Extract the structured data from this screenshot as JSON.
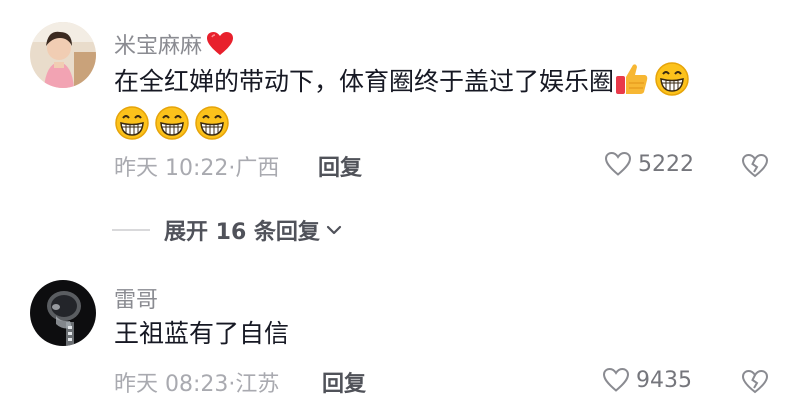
{
  "comments": [
    {
      "username": "米宝麻麻",
      "text": "在全红婵的带动下，体育圈终于盖过了娱乐圈",
      "time": "昨天 10:22·广西",
      "reply_label": "回复",
      "likes": "5222",
      "username_emoji": "red-heart",
      "text_emojis": [
        "thumbs-up",
        "grin",
        "grin",
        "grin",
        "grin"
      ]
    },
    {
      "username": "雷哥",
      "text": "王祖蓝有了自信",
      "time": "昨天 08:23·江苏",
      "reply_label": "回复",
      "likes": "9435"
    }
  ],
  "expand": {
    "label": "展开 16 条回复"
  },
  "colors": {
    "username": "#8a8b91",
    "meta": "#a9aab0",
    "text": "#161823"
  }
}
